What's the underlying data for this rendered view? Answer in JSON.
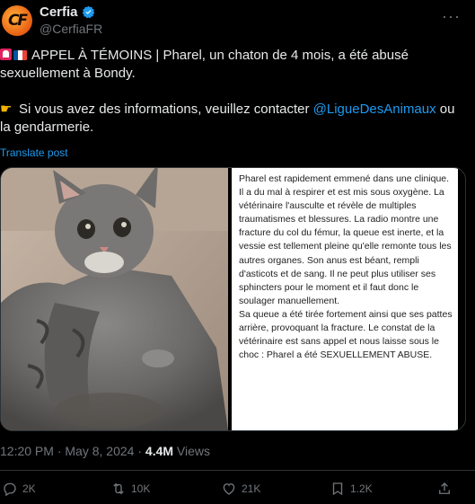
{
  "account": {
    "display_name": "Cerfia",
    "handle": "@CerfiaFR",
    "avatar_letters": "CF",
    "verified": true
  },
  "post": {
    "line1": "APPEL À TÉMOINS | Pharel, un chaton de 4 mois, a été abusé sexuellement à Bondy.",
    "line2_prefix": "Si vous avez des informations, veuillez contacter ",
    "mention": "@LigueDesAnimaux",
    "line2_suffix": " ou la gendarmerie.",
    "translate_label": "Translate post"
  },
  "document_text": "Pharel est rapidement emmené dans une clinique. Il a du mal à respirer et est mis sous oxygène. La vétérinaire l'ausculte et révèle de multiples traumatismes et blessures. La radio montre une fracture du col du fémur, la queue est inerte, et la vessie est tellement pleine qu'elle remonte tous les autres organes. Son anus est béant, rempli d'asticots et de sang. Il ne peut plus utiliser ses sphincters pour le moment et il faut donc le soulager manuellement.\nSa queue a été tirée fortement ainsi que ses pattes arrière, provoquant la fracture. Le constat de la vétérinaire est sans appel et nous laisse sous le choc : Pharel a été SEXUELLEMENT ABUSE.",
  "meta": {
    "time": "12:20 PM",
    "date": "May 8, 2024",
    "views_count": "4.4M",
    "views_label": "Views"
  },
  "actions": {
    "replies": "2K",
    "reposts": "10K",
    "likes": "21K",
    "bookmarks": "1.2K"
  },
  "colors": {
    "background": "#000000",
    "text": "#e7e9ea",
    "muted": "#71767b",
    "link": "#1d9bf0",
    "verified": "#1d9bf0"
  }
}
